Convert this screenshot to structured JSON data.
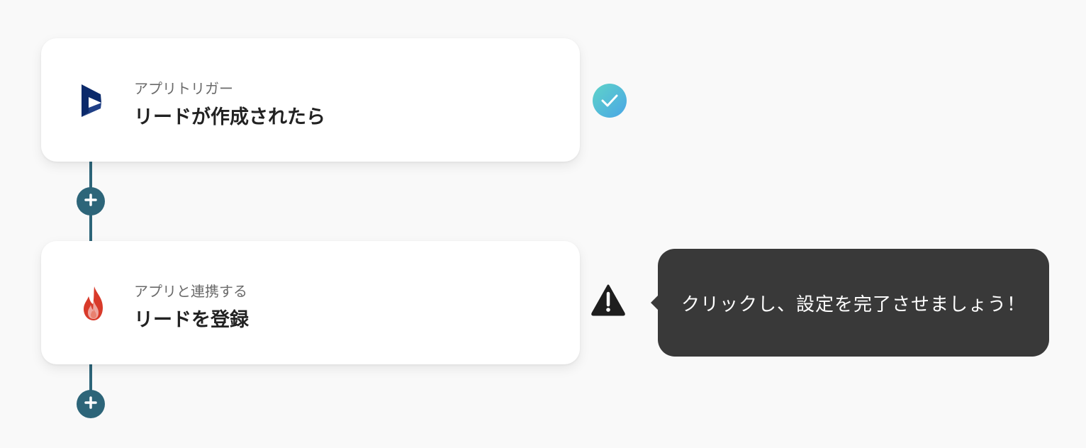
{
  "flow": {
    "steps": [
      {
        "kind_label": "アプリトリガー",
        "title": "リードが作成されたら",
        "icon": "dynamics-365-icon",
        "status": "complete",
        "status_icon": "check-circle-icon"
      },
      {
        "kind_label": "アプリと連携する",
        "title": "リードを登録",
        "icon": "flame-app-icon",
        "status": "warning",
        "status_icon": "warning-triangle-icon"
      }
    ],
    "add_step_icon": "plus-icon",
    "tooltip": {
      "text": "クリックし、設定を完了させましょう！"
    }
  },
  "colors": {
    "background": "#f9f9f9",
    "connector": "#2d6579",
    "complete_gradient_start": "#5fd3c8",
    "complete_gradient_end": "#4aa6e6",
    "warning": "#1e1e1e",
    "tooltip_bg": "#393939",
    "dynamics_navy": "#0b2a6b",
    "flame_red": "#d83a2a"
  }
}
